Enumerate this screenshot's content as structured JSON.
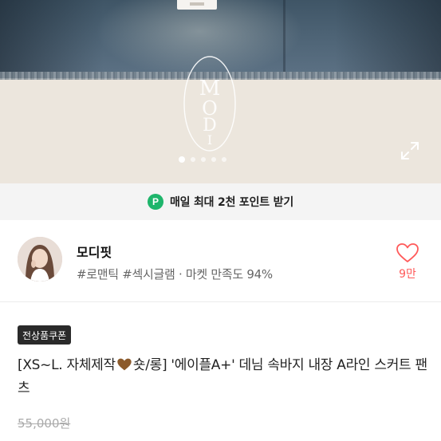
{
  "gallery": {
    "watermark_text": "MODI",
    "page_count": 5,
    "active_index": 0
  },
  "points_banner": {
    "badge": "P",
    "text": "매일 최대 2천 포인트 받기"
  },
  "shop": {
    "name": "모디핏",
    "tags": "#로맨틱 #섹시글램 · 마켓 만족도 94%",
    "like_count": "9만"
  },
  "product": {
    "coupon_label": "전상품쿠폰",
    "title_before_emoji": "[XS~L. 자체제작",
    "title_after_emoji": "숏/롱] '에이플A+' 데님 속바지 내장 A라인 스커트 팬츠",
    "original_price": "55,000원"
  },
  "colors": {
    "point_green": "#1eb56b",
    "like_red": "#ff5a5a",
    "heart_brown": "#8b5a2b"
  }
}
